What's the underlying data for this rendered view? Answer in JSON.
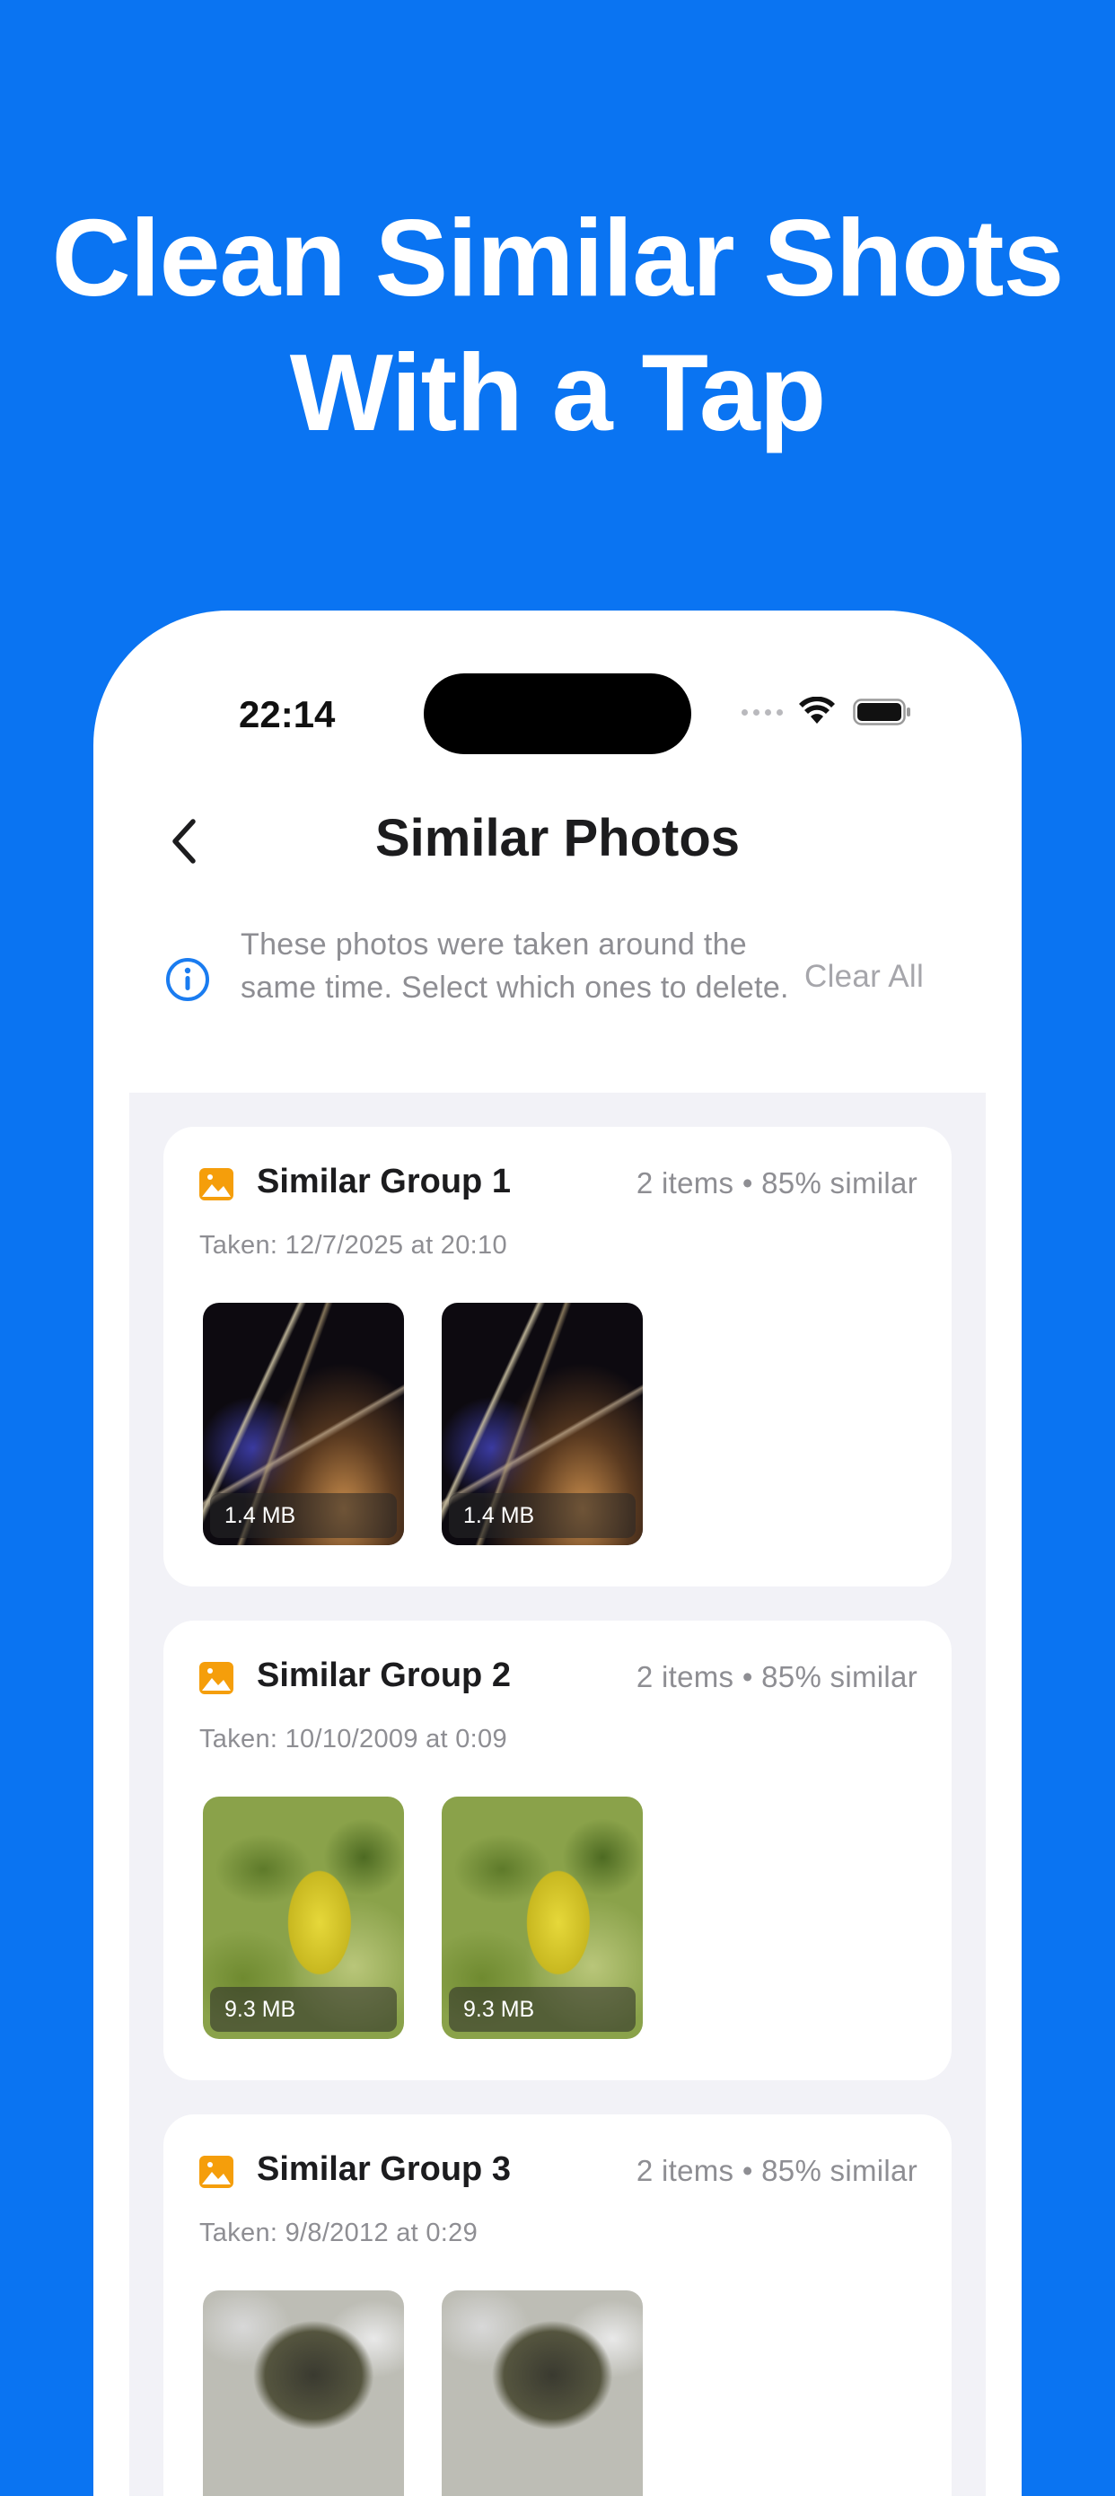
{
  "headline": {
    "line1": "Clean Similar Shots",
    "line2": "With a Tap"
  },
  "status_bar": {
    "time": "22:14",
    "icons": [
      "signal-dots",
      "wifi-icon",
      "battery-icon"
    ]
  },
  "nav": {
    "back_icon": "chevron-left-icon",
    "title": "Similar Photos"
  },
  "info": {
    "icon": "info-circle-icon",
    "text": "These photos were taken around the same time. Select which ones to delete.",
    "clear_all": "Clear All"
  },
  "groups": [
    {
      "title": "Similar Group 1",
      "meta": "2 items • 85% similar",
      "date": "Taken: 12/7/2025 at 20:10",
      "photos": [
        {
          "size": "1.4 MB",
          "image": "night-lights"
        },
        {
          "size": "1.4 MB",
          "image": "night-lights"
        }
      ]
    },
    {
      "title": "Similar Group 2",
      "meta": "2 items • 85% similar",
      "date": "Taken: 10/10/2009 at 0:09",
      "photos": [
        {
          "size": "9.3 MB",
          "image": "green-leaf"
        },
        {
          "size": "9.3 MB",
          "image": "green-leaf"
        }
      ]
    },
    {
      "title": "Similar Group 3",
      "meta": "2 items • 85% similar",
      "date": "Taken: 9/8/2012 at 0:29",
      "photos": [
        {
          "image": "waterfall-rock"
        },
        {
          "image": "waterfall-rock"
        }
      ]
    }
  ],
  "colors": {
    "background": "#0a74f2",
    "accent": "#1a7cf0",
    "group_icon": "#f59e0b"
  }
}
